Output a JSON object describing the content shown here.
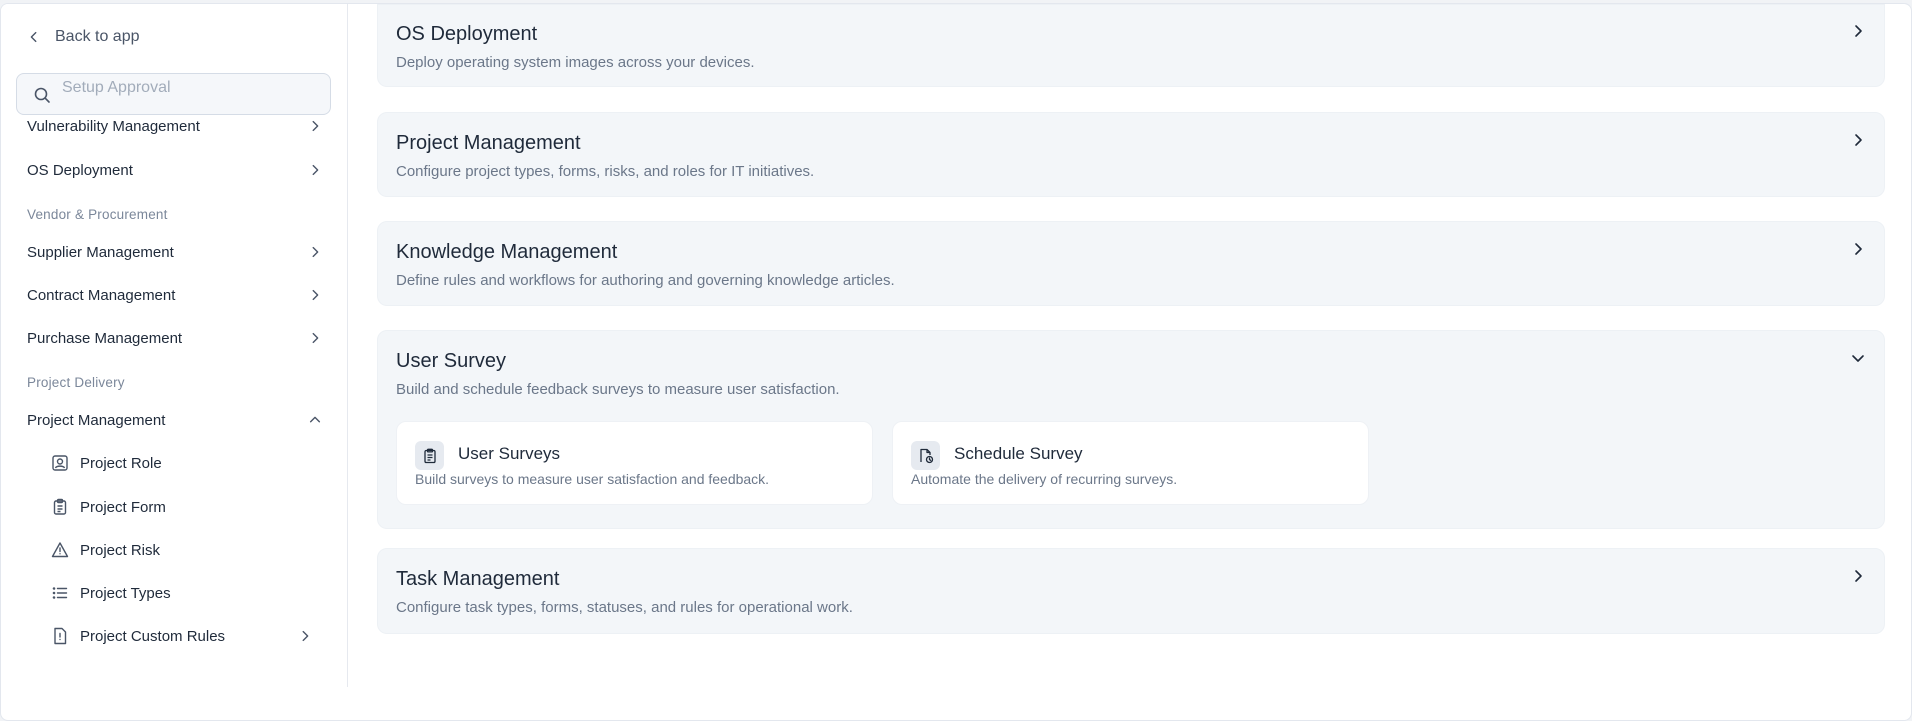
{
  "sidebar": {
    "back_label": "Back to app",
    "search": {
      "placeholder": "Setup Approval",
      "value": ""
    },
    "items_top": [
      {
        "label": "Vulnerability Management"
      },
      {
        "label": "OS Deployment"
      }
    ],
    "section_vendor": "Vendor & Procurement",
    "items_vendor": [
      {
        "label": "Supplier Management"
      },
      {
        "label": "Contract Management"
      },
      {
        "label": "Purchase Management"
      }
    ],
    "section_project": "Project Delivery",
    "project_management": {
      "label": "Project Management",
      "expanded": true
    },
    "project_sub_items": [
      {
        "label": "Project Role",
        "icon": "user-square-icon"
      },
      {
        "label": "Project Form",
        "icon": "clipboard-icon"
      },
      {
        "label": "Project Risk",
        "icon": "warning-triangle-icon"
      },
      {
        "label": "Project Types",
        "icon": "list-icon"
      },
      {
        "label": "Project Custom Rules",
        "icon": "file-alert-icon"
      }
    ]
  },
  "main": {
    "cards": [
      {
        "title": "OS Deployment",
        "description": "Deploy operating system images across your devices.",
        "expanded": false
      },
      {
        "title": "Project Management",
        "description": "Configure project types, forms, risks, and roles for IT initiatives.",
        "expanded": false
      },
      {
        "title": "Knowledge Management",
        "description": "Define rules and workflows for authoring and governing knowledge articles.",
        "expanded": false
      },
      {
        "title": "User Survey",
        "description": "Build and schedule feedback surveys to measure user satisfaction.",
        "expanded": true,
        "sub_cards": [
          {
            "title": "User Surveys",
            "description": "Build surveys to measure user satisfaction and feedback.",
            "icon": "clipboard-icon"
          },
          {
            "title": "Schedule Survey",
            "description": "Automate the delivery of recurring surveys.",
            "icon": "file-clock-icon"
          }
        ]
      },
      {
        "title": "Task Management",
        "description": "Configure task types, forms, statuses, and rules for operational work.",
        "expanded": false
      }
    ]
  },
  "colors": {
    "text_primary": "#1f2a3a",
    "text_muted": "#6b7789",
    "section_label": "#7b879a",
    "card_background": "#f3f6f9",
    "sub_card_background": "#ffffff"
  }
}
